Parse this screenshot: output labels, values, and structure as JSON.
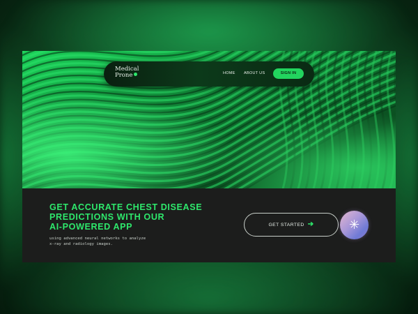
{
  "nav": {
    "brand_line1": "Medical",
    "brand_line2": "Prone",
    "home_label": "HOME",
    "about_label": "ABOUT US",
    "signin_label": "SIGN IN"
  },
  "hero": {
    "headline_line1": "GET ACCURATE CHEST DISEASE",
    "headline_line2": "PREDICTIONS WITH OUR",
    "headline_line3": "AI-POWERED APP",
    "subtext_line1": "using advanced neural networks to analyze",
    "subtext_line2": "x-ray and radiology images."
  },
  "cta": {
    "label": "GET STARTED",
    "arrow_icon": "arrow-right-icon",
    "orb_icon": "asterisk-icon"
  },
  "colors": {
    "accent_green": "#2ee86c",
    "panel_dark": "#1c1d1c"
  }
}
